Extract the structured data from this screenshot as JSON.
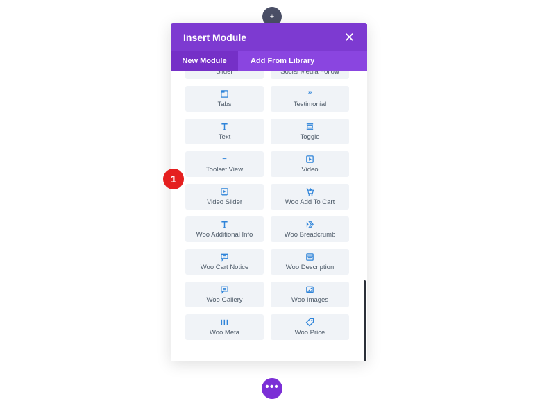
{
  "modal": {
    "title": "Insert Module",
    "close_glyph": "✕",
    "tabs": [
      "New Module",
      "Add From Library"
    ]
  },
  "modules": [
    {
      "label": "Slider",
      "icon": "slider-icon"
    },
    {
      "label": "Social Media Follow",
      "icon": "user-icon"
    },
    {
      "label": "Tabs",
      "icon": "tabs-icon"
    },
    {
      "label": "Testimonial",
      "icon": "quote-icon"
    },
    {
      "label": "Text",
      "icon": "text-icon"
    },
    {
      "label": "Toggle",
      "icon": "toggle-icon"
    },
    {
      "label": "Toolset View",
      "icon": "toolset-icon"
    },
    {
      "label": "Video",
      "icon": "play-icon"
    },
    {
      "label": "Video Slider",
      "icon": "video-slider-icon"
    },
    {
      "label": "Woo Add To Cart",
      "icon": "cart-add-icon"
    },
    {
      "label": "Woo Additional Info",
      "icon": "text-icon"
    },
    {
      "label": "Woo Breadcrumb",
      "icon": "breadcrumb-icon"
    },
    {
      "label": "Woo Cart Notice",
      "icon": "notice-icon"
    },
    {
      "label": "Woo Description",
      "icon": "description-icon"
    },
    {
      "label": "Woo Gallery",
      "icon": "gallery-icon"
    },
    {
      "label": "Woo Images",
      "icon": "images-icon"
    },
    {
      "label": "Woo Meta",
      "icon": "barcode-icon"
    },
    {
      "label": "Woo Price",
      "icon": "price-tag-icon"
    }
  ],
  "marker": {
    "number": "1"
  },
  "bottom_button": {
    "glyph": "•••"
  },
  "colors": {
    "header": "#7d3ad1",
    "tab_active": "#7530c7",
    "icon": "#2f84d9",
    "marker": "#e51f1f"
  }
}
